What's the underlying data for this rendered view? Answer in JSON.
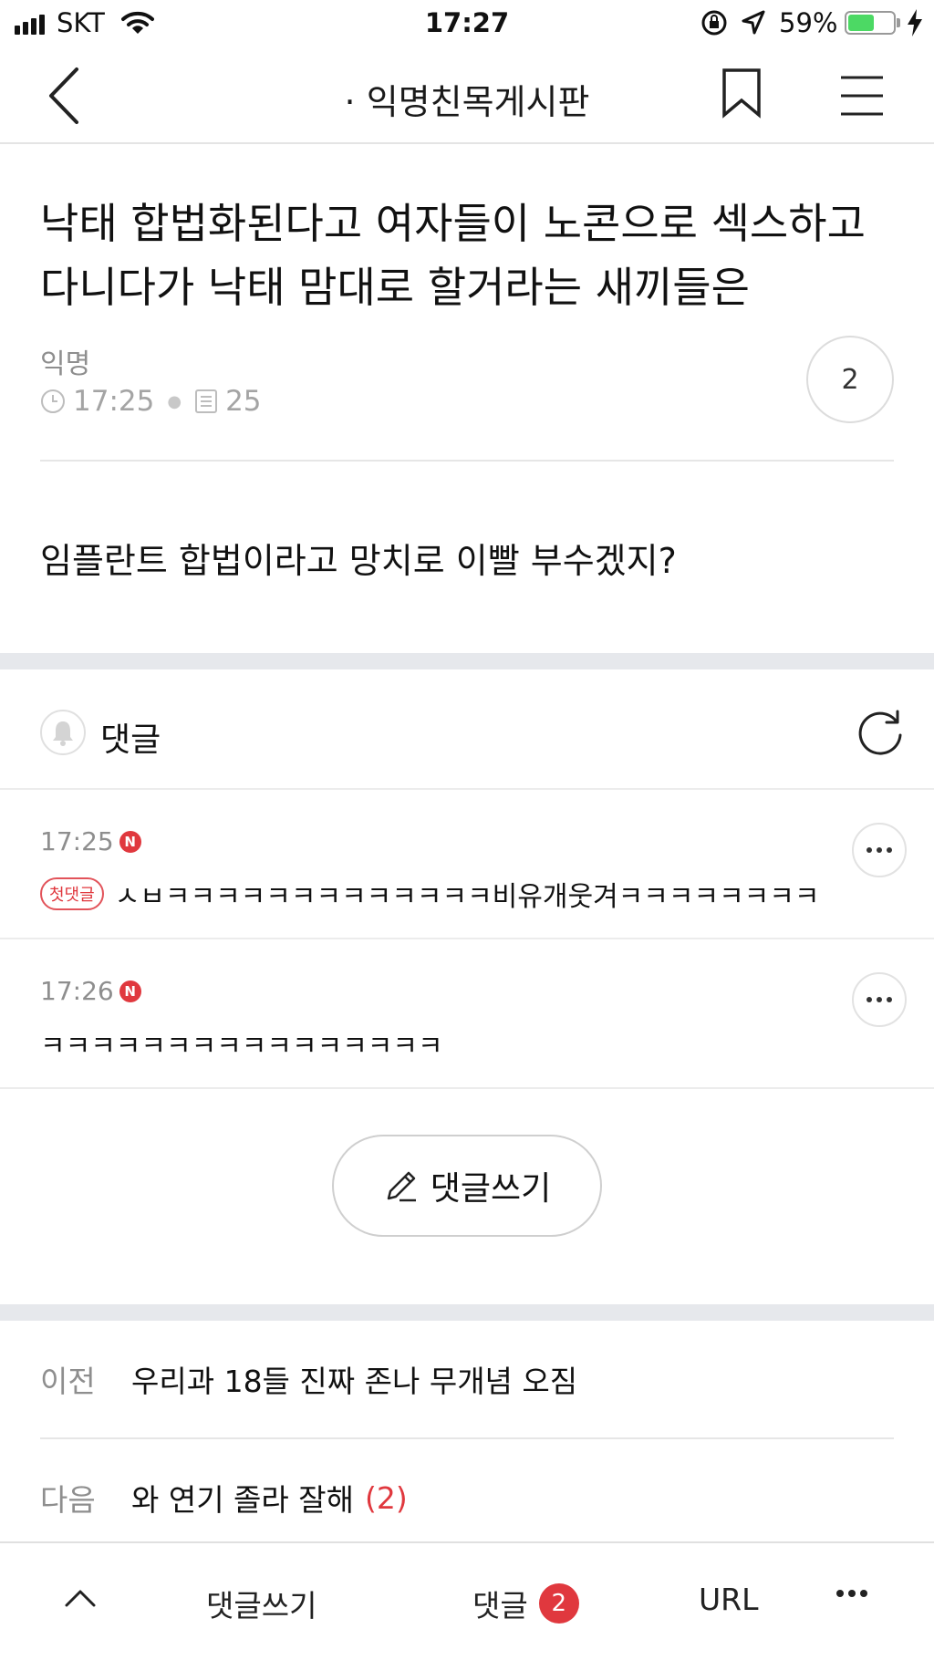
{
  "status_bar": {
    "carrier": "SKT",
    "time": "17:27",
    "battery": "59%",
    "battery_level": 0.59
  },
  "nav": {
    "title": "· 익명친목게시판",
    "back_icon": "chevron-left-icon",
    "bookmark_icon": "bookmark-icon",
    "menu_icon": "hamburger-menu-icon"
  },
  "post": {
    "title": "낙태 합법화된다고 여자들이 노콘으로 섹스하고 다니다가 낙태 맘대로 할거라는 새끼들은",
    "author": "익명",
    "time": "17:25",
    "views": "25",
    "comment_count": "2",
    "body": "임플란트 합법이라고 망치로 이빨 부수겠지?"
  },
  "comments": {
    "header": "댓글",
    "items": [
      {
        "time": "17:25",
        "new_badge": "N",
        "first_badge": "첫댓글",
        "text": "ㅅㅂㅋㅋㅋㅋㅋㅋㅋㅋㅋㅋㅋㅋㅋ비유개웃겨ㅋㅋㅋㅋㅋㅋㅋㅋ"
      },
      {
        "time": "17:26",
        "new_badge": "N",
        "first_badge": "",
        "text": "ㅋㅋㅋㅋㅋㅋㅋㅋㅋㅋㅋㅋㅋㅋㅋㅋ"
      }
    ],
    "write_button": "댓글쓰기"
  },
  "navigation": {
    "prev_label": "이전",
    "prev_title": "우리과 18들 진짜 존나 무개념 오짐",
    "next_label": "다음",
    "next_title": "와 연기 졸라 잘해",
    "next_count": "(2)"
  },
  "toolbar": {
    "write": "댓글쓰기",
    "comments": "댓글",
    "comments_badge": "2",
    "url": "URL"
  },
  "colors": {
    "accent_red": "#e0383e",
    "battery_green": "#4cd964",
    "band_gray": "#e6e8ec"
  }
}
